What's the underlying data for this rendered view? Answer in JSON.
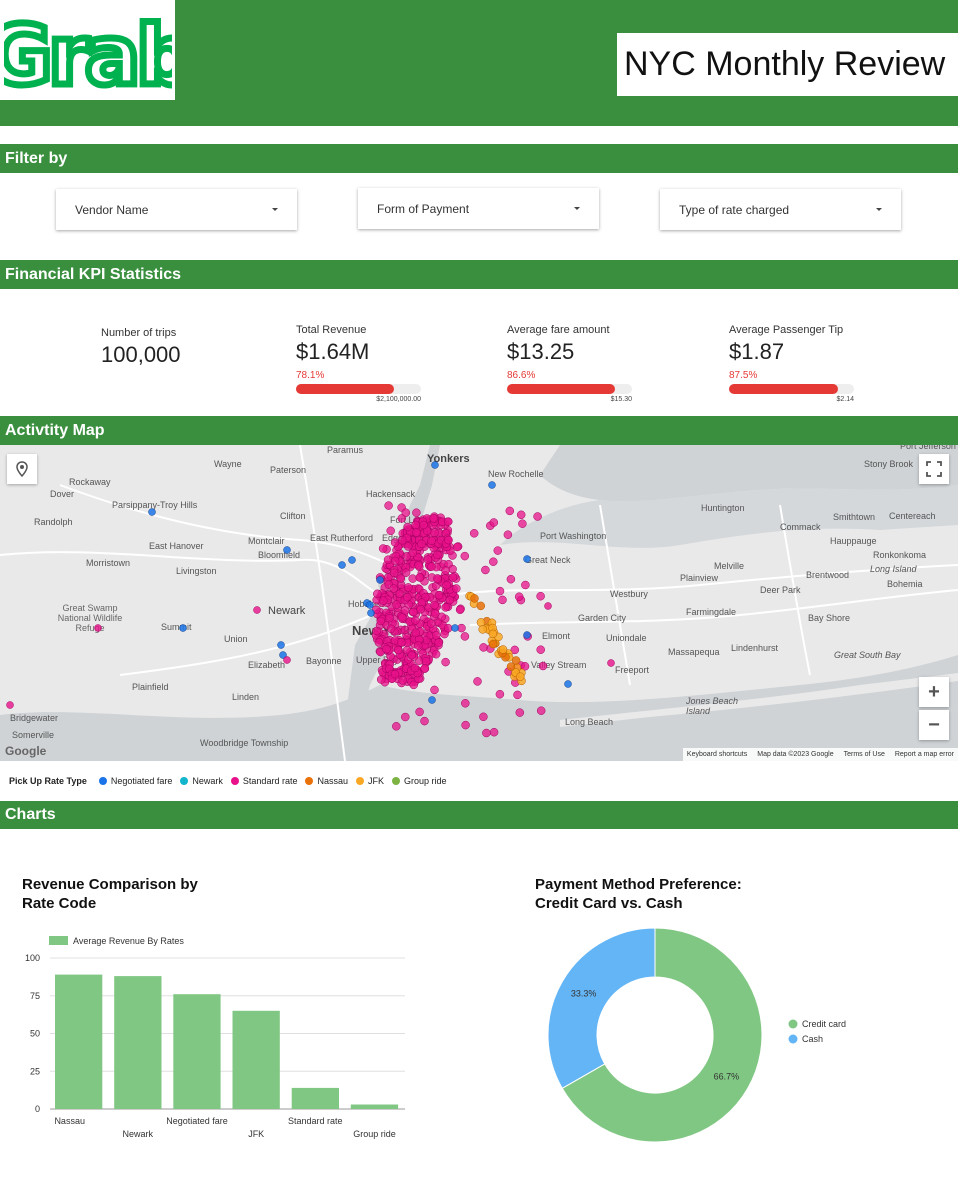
{
  "header": {
    "logo_text": "Grab",
    "title": "NYC Monthly Review"
  },
  "sections": {
    "filter": "Filter by",
    "kpi": "Financial KPI Statistics",
    "map": "Activtity Map",
    "charts": "Charts"
  },
  "filters": [
    {
      "label": "Vendor Name"
    },
    {
      "label": "Form of Payment"
    },
    {
      "label": "Type of rate charged"
    }
  ],
  "kpis": {
    "trips": {
      "label": "Number of trips",
      "value": "100,000"
    },
    "revenue": {
      "label": "Total Revenue",
      "value": "$1.64M",
      "pct": "78.1%",
      "progress": 0.781,
      "target": "$2,100,000.00"
    },
    "fare": {
      "label": "Average fare amount",
      "value": "$13.25",
      "pct": "86.6%",
      "progress": 0.866,
      "target": "$15.30"
    },
    "tip": {
      "label": "Average Passenger Tip",
      "value": "$1.87",
      "pct": "87.5%",
      "progress": 0.875,
      "target": "$2.14"
    }
  },
  "map": {
    "places": [
      "Paramus",
      "Yonkers",
      "Port Jefferson",
      "Wayne",
      "Paterson",
      "Stony Brook",
      "Rockaway",
      "New Rochelle",
      "Dover",
      "Parsippany-Troy Hills",
      "Hackensack",
      "Huntington",
      "Randolph",
      "Clifton",
      "Fort Lee",
      "Commack",
      "Smithtown",
      "Centereach",
      "East Rutherford",
      "Edgewater",
      "Port Washington",
      "Hauppauge",
      "East Hanover",
      "Montclair",
      "Bloomfield",
      "Great Neck",
      "Ronkonkoma",
      "Morristown",
      "Livingston",
      "Melville",
      "Brentwood",
      "Long Island",
      "Plainview",
      "Deer Park",
      "Bohemia",
      "Great Swamp National Wildlife Refuge",
      "Newark",
      "Hoboken",
      "Westbury",
      "Summit",
      "New York",
      "Garden City",
      "Farmingdale",
      "Bay Shore",
      "Union",
      "Elmont",
      "Uniondale",
      "Elizabeth",
      "Bayonne",
      "Valley Stream",
      "Massapequa",
      "Lindenhurst",
      "Great South Bay",
      "Freeport",
      "Plainfield",
      "Linden",
      "Jones Beach Island",
      "Bridgewater",
      "Long Beach",
      "Somerville",
      "Woodbridge Township",
      "Upper Bay"
    ],
    "google": "Google",
    "footer": [
      "Keyboard shortcuts",
      "Map data ©2023 Google",
      "Terms of Use",
      "Report a map error"
    ],
    "zoom_in": "+",
    "zoom_out": "−"
  },
  "map_legend": {
    "title": "Pick Up Rate Type",
    "items": [
      {
        "label": "Negotiated fare",
        "color": "#1a73e8"
      },
      {
        "label": "Newark",
        "color": "#12b5cb"
      },
      {
        "label": "Standard rate",
        "color": "#e8118a"
      },
      {
        "label": "Nassau",
        "color": "#e8710a"
      },
      {
        "label": "JFK",
        "color": "#f9a825"
      },
      {
        "label": "Group ride",
        "color": "#7cb342"
      }
    ]
  },
  "charts": {
    "bar_title_line1": "Revenue Comparison by",
    "bar_title_line2": "Rate Code",
    "pie_title_line1": "Payment Method Preference:",
    "pie_title_line2": "Credit Card vs. Cash"
  },
  "chart_data": [
    {
      "type": "bar",
      "title": "Revenue Comparison by Rate Code",
      "categories": [
        "Nassau",
        "Newark",
        "Negotiated fare",
        "JFK",
        "Standard rate",
        "Group ride"
      ],
      "series": [
        {
          "name": "Average Revenue By Rates",
          "values": [
            89,
            88,
            76,
            65,
            14,
            3
          ],
          "color": "#81c784"
        }
      ],
      "ylim": [
        0,
        100
      ],
      "yticks": [
        0,
        25,
        50,
        75,
        100
      ],
      "grid": true,
      "legend": "top-left"
    },
    {
      "type": "pie",
      "title": "Payment Method Preference: Credit Card vs. Cash",
      "slices": [
        {
          "name": "Credit card",
          "value": 66.7,
          "label": "66.7%",
          "color": "#81c784"
        },
        {
          "name": "Cash",
          "value": 33.3,
          "label": "33.3%",
          "color": "#64b5f6"
        }
      ],
      "legend": "right"
    }
  ]
}
